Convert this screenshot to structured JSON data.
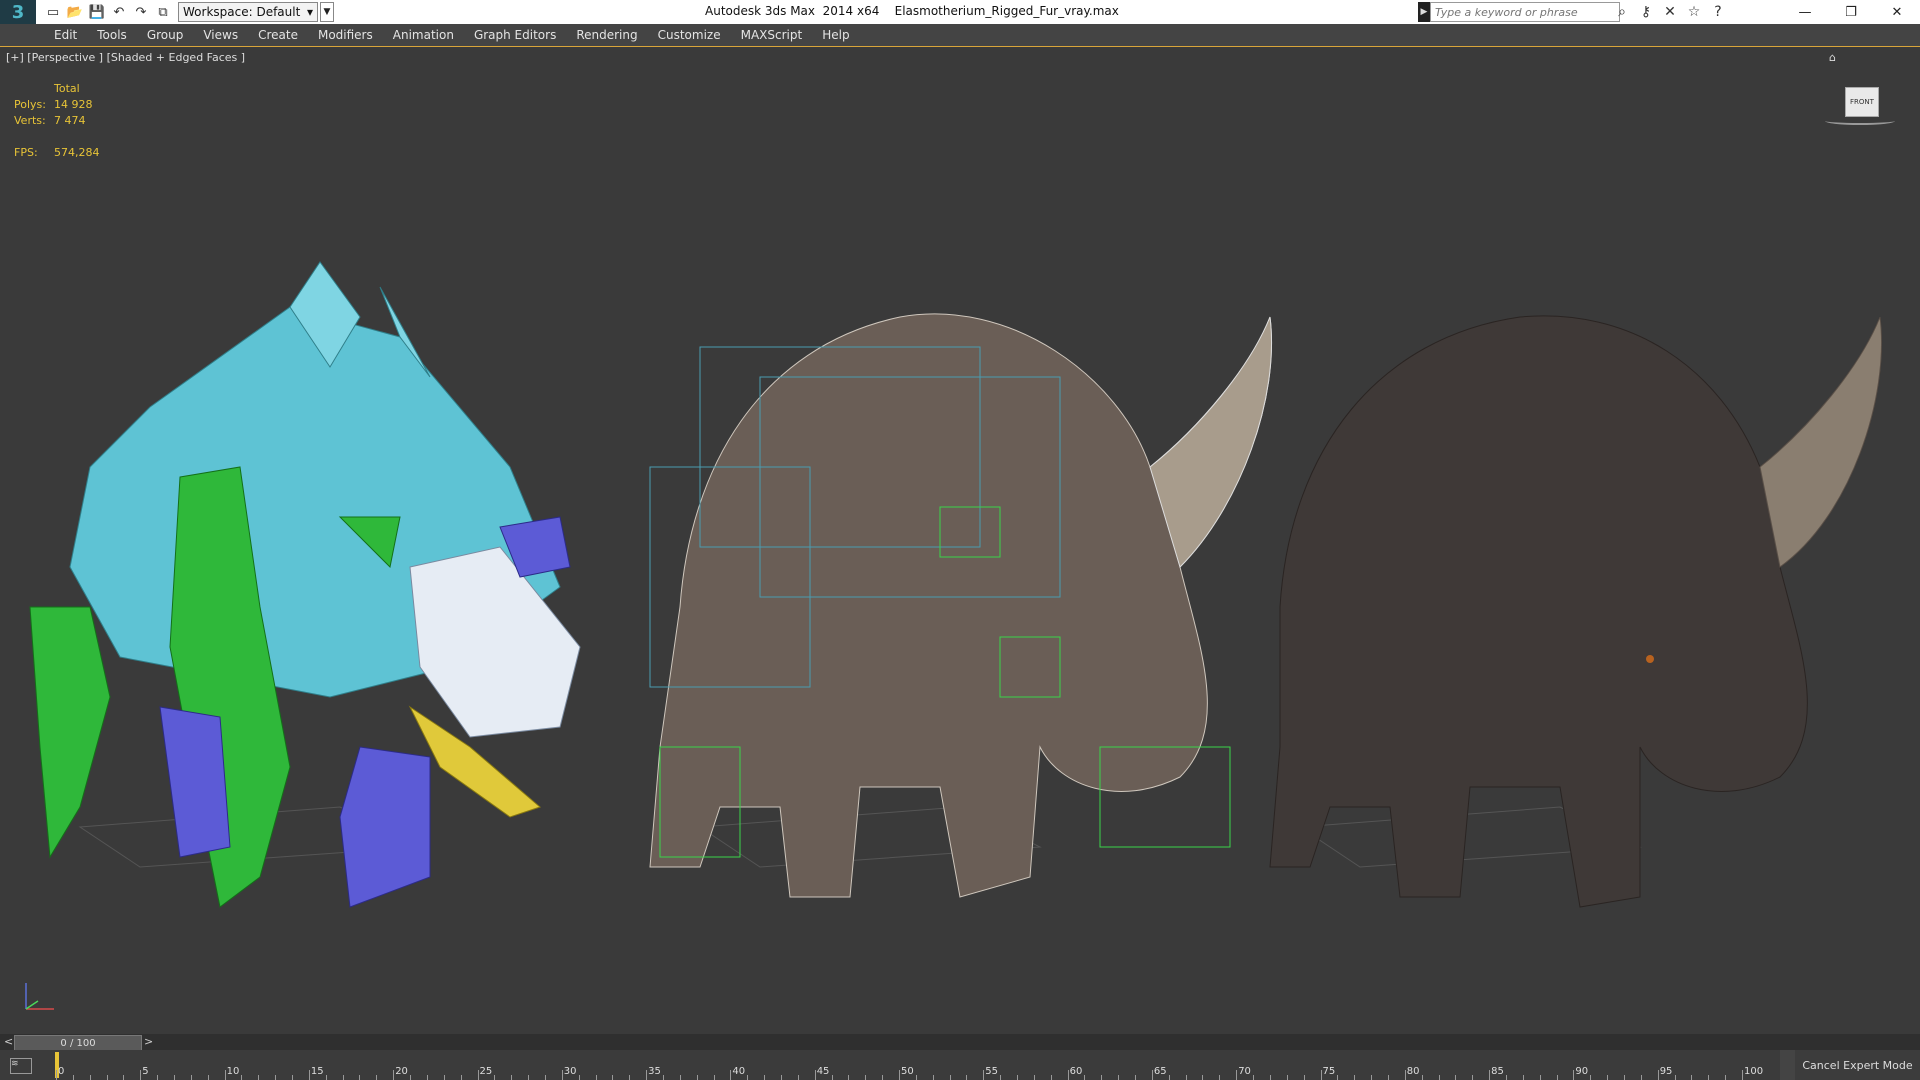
{
  "app": {
    "title": "Autodesk 3ds Max  2014 x64    Elasmotherium_Rigged_Fur_vray.max",
    "logo_label": "3"
  },
  "workspace": {
    "label": "Workspace: Default"
  },
  "search": {
    "placeholder": "Type a keyword or phrase"
  },
  "menu": [
    "Edit",
    "Tools",
    "Group",
    "Views",
    "Create",
    "Modifiers",
    "Animation",
    "Graph Editors",
    "Rendering",
    "Customize",
    "MAXScript",
    "Help"
  ],
  "viewport": {
    "label": "[+] [Perspective ] [Shaded + Edged Faces ]",
    "stats": {
      "header": "Total",
      "polys_label": "Polys:",
      "polys": "14 928",
      "verts_label": "Verts:",
      "verts": "7 474",
      "fps_label": "FPS:",
      "fps": "574,284"
    },
    "viewcube_label": "FRONT"
  },
  "timeline": {
    "frame_display": "0 / 100",
    "prev": "<",
    "next": ">",
    "ticks": [
      "0",
      "5",
      "10",
      "15",
      "20",
      "25",
      "30",
      "35",
      "40",
      "45",
      "50",
      "55",
      "60",
      "65",
      "70",
      "75",
      "80",
      "85",
      "90",
      "95",
      "100"
    ],
    "cancel_expert": "Cancel Expert Mode"
  },
  "colors": {
    "accent": "#e8c437",
    "viewport_bg": "#3a3a3a"
  }
}
